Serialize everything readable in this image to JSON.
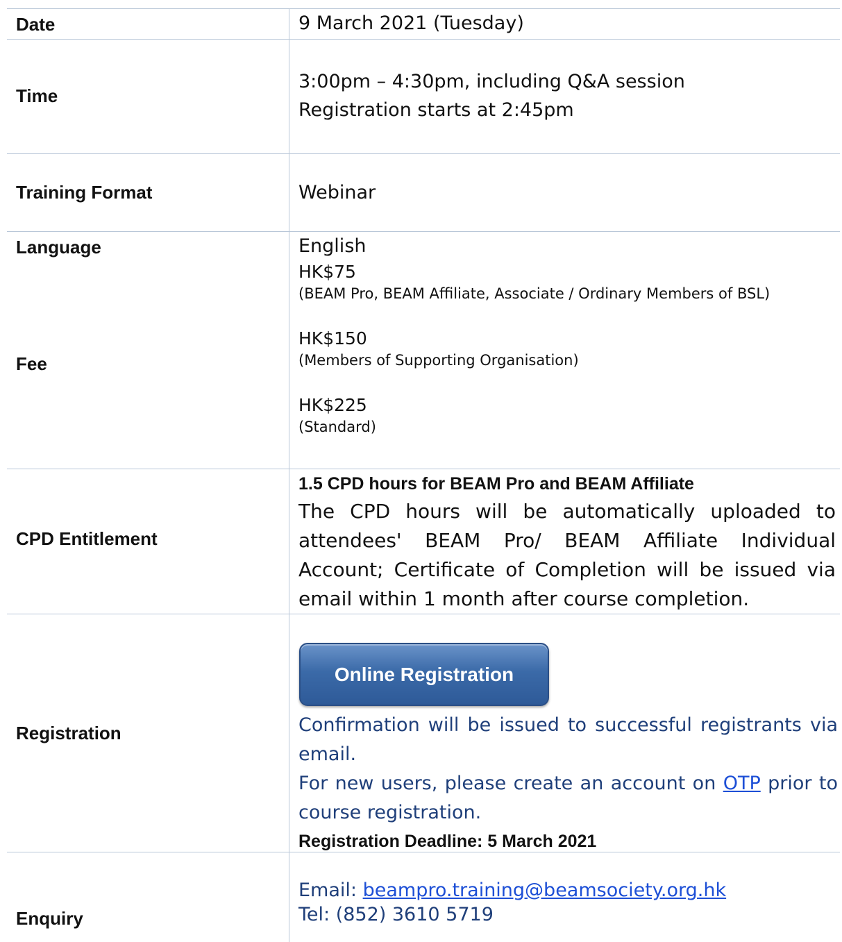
{
  "date": {
    "label": "Date",
    "value": "9 March 2021 (Tuesday)"
  },
  "time": {
    "label": "Time",
    "line1": "3:00pm – 4:30pm, including Q&A session",
    "line2": "Registration starts at 2:45pm"
  },
  "format": {
    "label": "Training Format",
    "value": "Webinar"
  },
  "language": {
    "label": "Language",
    "value": "English"
  },
  "fee": {
    "label": "Fee",
    "items": [
      {
        "price": "HK$75",
        "note": "(BEAM Pro, BEAM Affiliate, Associate / Ordinary Members of BSL)"
      },
      {
        "price": "HK$150",
        "note": "(Members of Supporting Organisation)"
      },
      {
        "price": "HK$225",
        "note": "(Standard)"
      }
    ]
  },
  "cpd": {
    "label": "CPD Entitlement",
    "heading": "1.5 CPD hours for BEAM Pro and BEAM Affiliate",
    "body": "The CPD hours will be automatically uploaded to attendees' BEAM Pro/ BEAM Affiliate Individual Account; Certificate of Completion will be issued via email within 1 month after course completion."
  },
  "registration": {
    "label": "Registration",
    "button": "Online Registration",
    "confirmation": "Confirmation will be issued to successful registrants via email.",
    "new_users_before": "For new users, please create an account on ",
    "otp_link": "OTP",
    "new_users_after": " prior to course registration.",
    "deadline": "Registration Deadline:  5 March 2021"
  },
  "enquiry": {
    "label": "Enquiry",
    "email_label": "Email: ",
    "email": "beampro.training@beamsociety.org.hk",
    "tel": "Tel: (852) 3610 5719"
  }
}
